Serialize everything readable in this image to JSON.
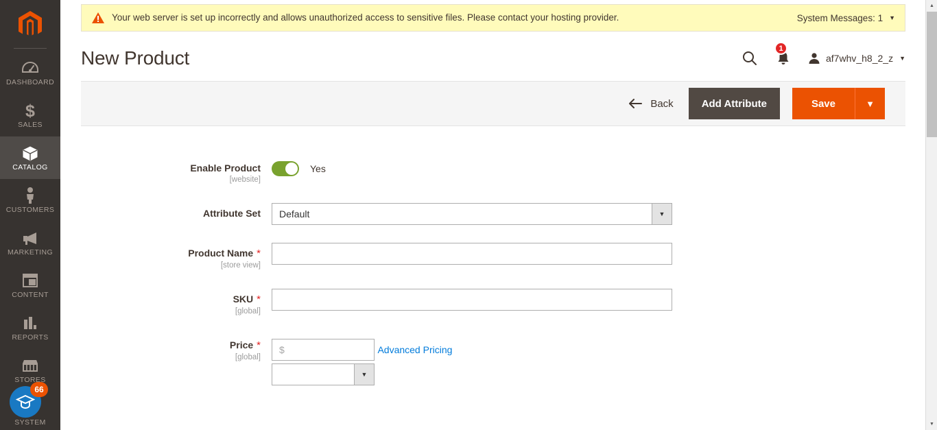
{
  "sidebar": {
    "logo_name": "magento-logo",
    "items": [
      {
        "label": "DASHBOARD",
        "icon": "dashboard-icon",
        "active": false
      },
      {
        "label": "SALES",
        "icon": "dollar-icon",
        "active": false
      },
      {
        "label": "CATALOG",
        "icon": "box-icon",
        "active": true
      },
      {
        "label": "CUSTOMERS",
        "icon": "person-icon",
        "active": false
      },
      {
        "label": "MARKETING",
        "icon": "megaphone-icon",
        "active": false
      },
      {
        "label": "CONTENT",
        "icon": "layout-icon",
        "active": false
      },
      {
        "label": "REPORTS",
        "icon": "bar-chart-icon",
        "active": false
      },
      {
        "label": "STORES",
        "icon": "storefront-icon",
        "active": false
      },
      {
        "label": "SYSTEM",
        "icon": "gear-icon",
        "active": false
      }
    ],
    "guide_badge_count": "66",
    "guide_badge_color": "#1979c3",
    "guide_count_color": "#eb5202"
  },
  "banner": {
    "icon": "warning-triangle-icon",
    "message": "Your web server is set up incorrectly and allows unauthorized access to sensitive files. Please contact your hosting provider.",
    "system_messages_label": "System Messages: 1",
    "caret": "▼",
    "background": "#fffbbb"
  },
  "header": {
    "title": "New Product",
    "search_icon": "search-icon",
    "bell_icon": "notification-bell-icon",
    "bell_count": "1",
    "bell_count_color": "#e22626",
    "avatar_icon": "user-avatar-icon",
    "username": "af7whv_h8_2_z",
    "caret": "▼"
  },
  "toolbar": {
    "back_label": "Back",
    "back_icon": "arrow-left-icon",
    "add_attribute_label": "Add Attribute",
    "save_label": "Save",
    "save_caret": "▼",
    "save_color": "#eb5202",
    "add_attribute_color": "#514943"
  },
  "form": {
    "fields": {
      "enable_product": {
        "label": "Enable Product",
        "scope": "[website]",
        "toggle_state": "Yes",
        "toggle_on": true,
        "toggle_color": "#79a22e"
      },
      "attribute_set": {
        "label": "Attribute Set",
        "value": "Default",
        "caret": "▼"
      },
      "product_name": {
        "label": "Product Name",
        "required": "*",
        "scope": "[store view]",
        "value": "",
        "placeholder": ""
      },
      "sku": {
        "label": "SKU",
        "required": "*",
        "scope": "[global]",
        "value": "",
        "placeholder": ""
      },
      "price": {
        "label": "Price",
        "required": "*",
        "scope": "[global]",
        "value": "",
        "placeholder": "$",
        "advanced_pricing_link": "Advanced Pricing",
        "link_color": "#007bdb"
      },
      "next_partial": {
        "value": "",
        "caret": "▼"
      }
    }
  },
  "scrollbar": {
    "up_arrow": "▲",
    "down_arrow": "▼"
  }
}
